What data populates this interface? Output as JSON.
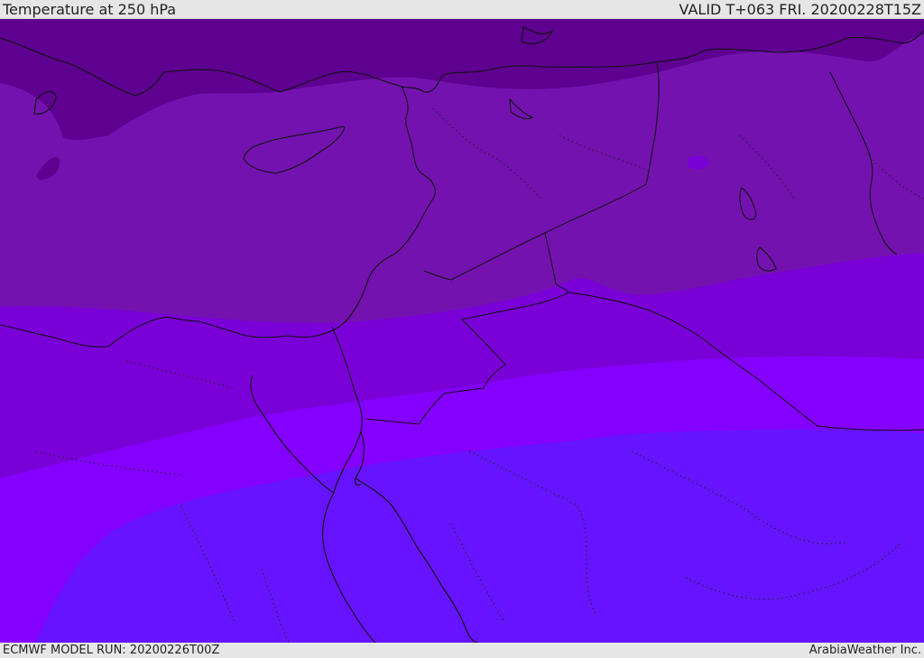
{
  "header": {
    "title": "Temperature at 250 hPa",
    "valid_time": "VALID T+063 FRI. 20200228T15Z"
  },
  "footer": {
    "model_run": "ECMWF MODEL RUN: 20200226T00Z",
    "credit": "ArabiaWeather Inc."
  },
  "colors": {
    "band_coldest": "#5e0090",
    "band_cold": "#7412b0",
    "band_mid": "#7a00d8",
    "band_warm": "#8400ff",
    "band_warmest": "#6614ff",
    "coast": "#111111"
  }
}
